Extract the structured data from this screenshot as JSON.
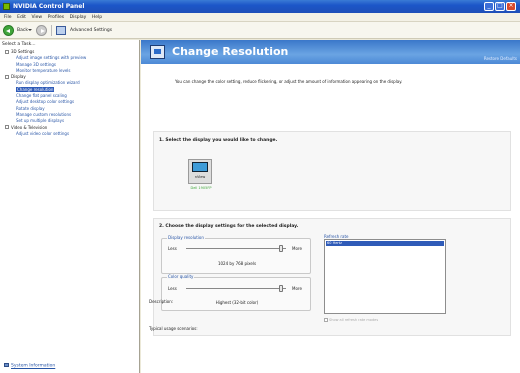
{
  "window": {
    "title": "NVIDIA Control Panel",
    "min_glyph": "_",
    "max_glyph": "□",
    "close_glyph": "×"
  },
  "menu": [
    "File",
    "Edit",
    "View",
    "Profiles",
    "Display",
    "Help"
  ],
  "toolbar": {
    "back_label": "Back",
    "advanced_label": "Advanced Settings"
  },
  "taskpane": {
    "header": "Select a Task...",
    "tree": [
      {
        "type": "category",
        "label": "3D Settings"
      },
      {
        "type": "item",
        "label": "Adjust image settings with preview"
      },
      {
        "type": "item",
        "label": "Manage 3D settings"
      },
      {
        "type": "item",
        "label": "Monitor temperature levels"
      },
      {
        "type": "category",
        "label": "Display"
      },
      {
        "type": "item",
        "label": "Run display optimization wizard"
      },
      {
        "type": "item",
        "label": "Change resolution",
        "selected": true
      },
      {
        "type": "item",
        "label": "Change flat panel scaling"
      },
      {
        "type": "item",
        "label": "Adjust desktop color settings"
      },
      {
        "type": "item",
        "label": "Rotate display"
      },
      {
        "type": "item",
        "label": "Manage custom resolutions"
      },
      {
        "type": "item",
        "label": "Set up multiple displays"
      },
      {
        "type": "category",
        "label": "Video & Television"
      },
      {
        "type": "item",
        "label": "Adjust video color settings"
      }
    ],
    "system_info": "System Information"
  },
  "main": {
    "title": "Change Resolution",
    "restore_defaults": "Restore Defaults",
    "intro": "You can change the color setting, reduce flickering, or adjust the amount of information appearing on the display.",
    "step1": {
      "title": "1. Select the display you would like to change.",
      "display_label": "nView",
      "display_name": "Dell 1905FP"
    },
    "step2": {
      "title": "2. Choose the display settings for the selected display.",
      "resolution": {
        "label": "Display resolution",
        "less": "Less",
        "more": "More",
        "value": "1024 by 768 pixels",
        "level": 0.95
      },
      "color": {
        "label": "Color quality",
        "less": "Less",
        "more": "More",
        "value": "Highest (32-bit color)",
        "level": 0.95
      },
      "refresh": {
        "label": "Refresh rate",
        "selected": "60 Hertz"
      },
      "hide_modes": "Show all refresh rate modes"
    },
    "description_label": "Description:",
    "usage_label": "Typical usage scenarios:"
  }
}
